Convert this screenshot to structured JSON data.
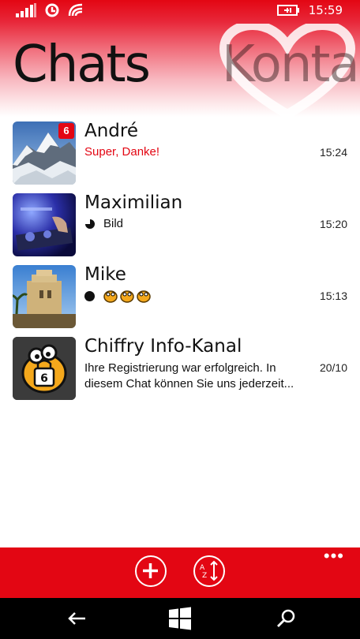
{
  "status": {
    "time": "15:59"
  },
  "pivot": {
    "active": "Chats",
    "next": "Kontak"
  },
  "chats": [
    {
      "name": "André",
      "preview": "Super, Danke!",
      "time": "15:24",
      "unread": "6"
    },
    {
      "name": "Maximilian",
      "preview": "Bild",
      "time": "15:20"
    },
    {
      "name": "Mike",
      "preview": "",
      "time": "15:13"
    },
    {
      "name": "Chiffry Info-Kanal",
      "preview": "Ihre Registrierung war erfolgreich. In diesem Chat können Sie uns jederzeit...",
      "time": "20/10"
    }
  ],
  "appbar": {
    "more": "•••",
    "icons": [
      "add-icon",
      "sort-az-icon"
    ]
  },
  "colors": {
    "accent": "#e30613"
  }
}
